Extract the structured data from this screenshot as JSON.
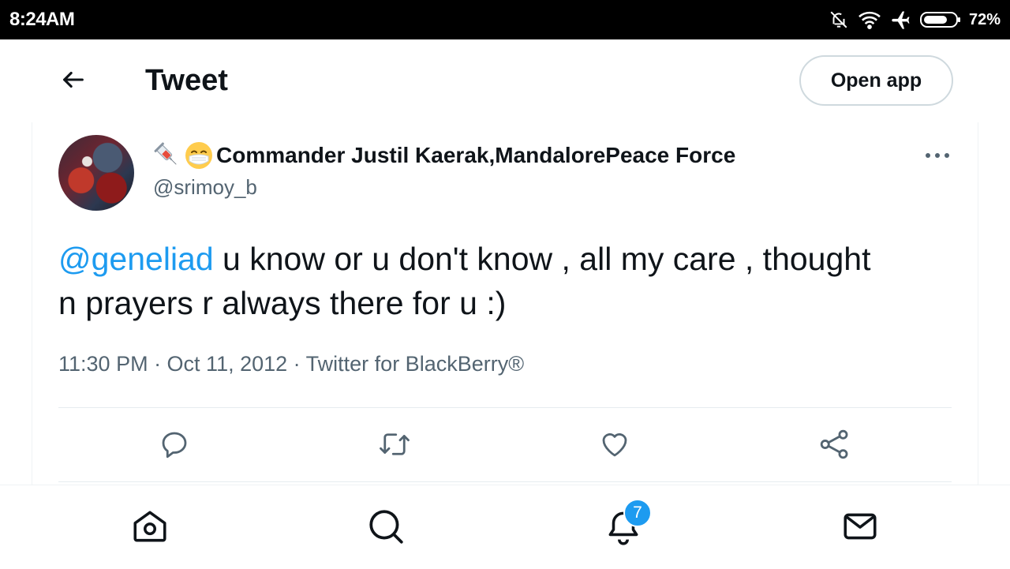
{
  "status_bar": {
    "time": "8:24AM",
    "battery_percent": "72%",
    "icons": [
      "bell-off-icon",
      "wifi-icon",
      "airplane-icon",
      "battery-icon"
    ]
  },
  "header": {
    "back_icon": "arrow-left-icon",
    "title": "Tweet",
    "open_app_label": "Open app"
  },
  "tweet": {
    "author": {
      "name_emojis": [
        "syringe-emoji",
        "face-with-mask-emoji"
      ],
      "display_name": "Commander Justil Kaerak,MandalorePeace Force",
      "handle": "@srimoy_b"
    },
    "text_mention": "@geneliad",
    "text_body": " u know or u don't know , all my care , thought n prayers r always there for u :)",
    "meta": "11:30 PM · Oct 11, 2012 · Twitter for BlackBerry®",
    "actions": [
      "reply-icon",
      "retweet-icon",
      "like-icon",
      "share-icon"
    ]
  },
  "bottom_nav": {
    "items": [
      "home-icon",
      "search-icon",
      "notifications-icon",
      "messages-icon"
    ],
    "notification_count": "7"
  },
  "colors": {
    "accent": "#1d9bf0",
    "text_primary": "#0f1419",
    "text_secondary": "#536471"
  }
}
